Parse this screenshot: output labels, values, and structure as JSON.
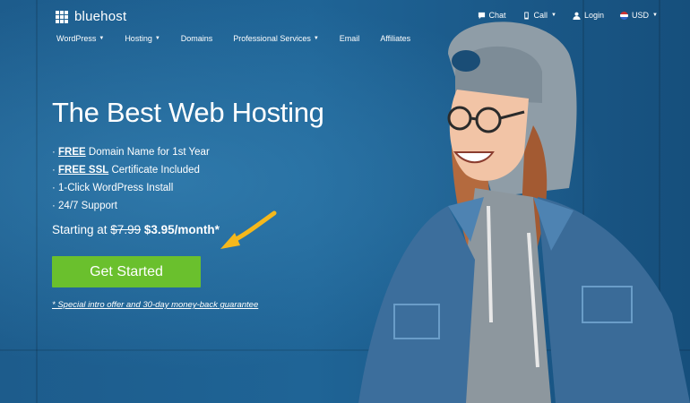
{
  "brand": {
    "name": "bluehost"
  },
  "utility_nav": [
    {
      "label": "Chat",
      "icon": "chat-icon"
    },
    {
      "label": "Call",
      "icon": "phone-icon"
    },
    {
      "label": "Login",
      "icon": "user-icon"
    },
    {
      "label": "USD",
      "icon": "flag-icon"
    }
  ],
  "main_nav": [
    {
      "label": "WordPress",
      "dropdown": true
    },
    {
      "label": "Hosting",
      "dropdown": true
    },
    {
      "label": "Domains",
      "dropdown": false
    },
    {
      "label": "Professional Services",
      "dropdown": true
    },
    {
      "label": "Email",
      "dropdown": false
    },
    {
      "label": "Affiliates",
      "dropdown": false
    }
  ],
  "hero": {
    "headline": "The Best Web Hosting",
    "features": [
      {
        "bold": "FREE",
        "text": " Domain Name for 1st Year"
      },
      {
        "bold": "FREE SSL",
        "text": " Certificate Included"
      },
      {
        "bold": "",
        "text": "1-Click WordPress Install"
      },
      {
        "bold": "",
        "text": "24/7 Support"
      }
    ],
    "price_prefix": "Starting at ",
    "price_old": "$7.99",
    "price_new": "$3.95/month*",
    "cta_label": "Get Started",
    "disclaimer": "* Special intro offer and 30-day money-back guarantee"
  },
  "colors": {
    "background": "#1f5d8f",
    "cta": "#6ac02d",
    "arrow": "#f5b81c"
  }
}
